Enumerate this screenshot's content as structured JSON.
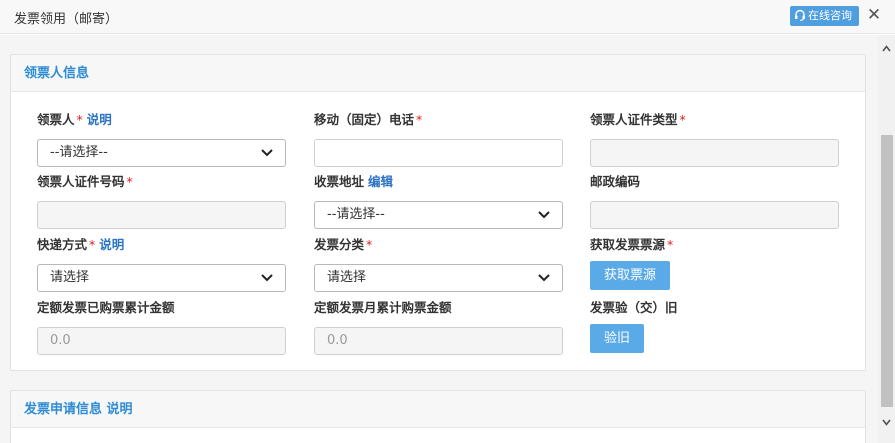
{
  "window": {
    "title": "发票领用（邮寄）",
    "online_consult": "在线咨询"
  },
  "section1": {
    "title": "领票人信息",
    "fields": {
      "recipient": {
        "label": "领票人",
        "required": "*",
        "link": "说明",
        "value": "--请选择--"
      },
      "phone": {
        "label": "移动（固定）电话",
        "required": "*",
        "value": ""
      },
      "id_type": {
        "label": "领票人证件类型",
        "required": "*",
        "value": ""
      },
      "id_number": {
        "label": "领票人证件号码",
        "required": "*",
        "value": ""
      },
      "address": {
        "label": "收票地址",
        "link": "编辑",
        "value": "--请选择--"
      },
      "postcode": {
        "label": "邮政编码",
        "value": ""
      },
      "delivery": {
        "label": "快递方式",
        "required": "*",
        "link": "说明",
        "value": "请选择"
      },
      "category": {
        "label": "发票分类",
        "required": "*",
        "value": "请选择"
      },
      "source": {
        "label": "获取发票票源",
        "required": "*",
        "button": "获取票源"
      },
      "quota_total": {
        "label": "定额发票已购票累计金额",
        "value": "0.0"
      },
      "quota_month": {
        "label": "定额发票月累计购票金额",
        "value": "0.0"
      },
      "verify": {
        "label": "发票验（交）旧",
        "button": "验旧"
      }
    }
  },
  "section2": {
    "title": "发票申请信息",
    "link": "说明"
  },
  "colors": {
    "accent": "#2e8cd5",
    "button": "#5aaae8",
    "required": "#e02020"
  }
}
